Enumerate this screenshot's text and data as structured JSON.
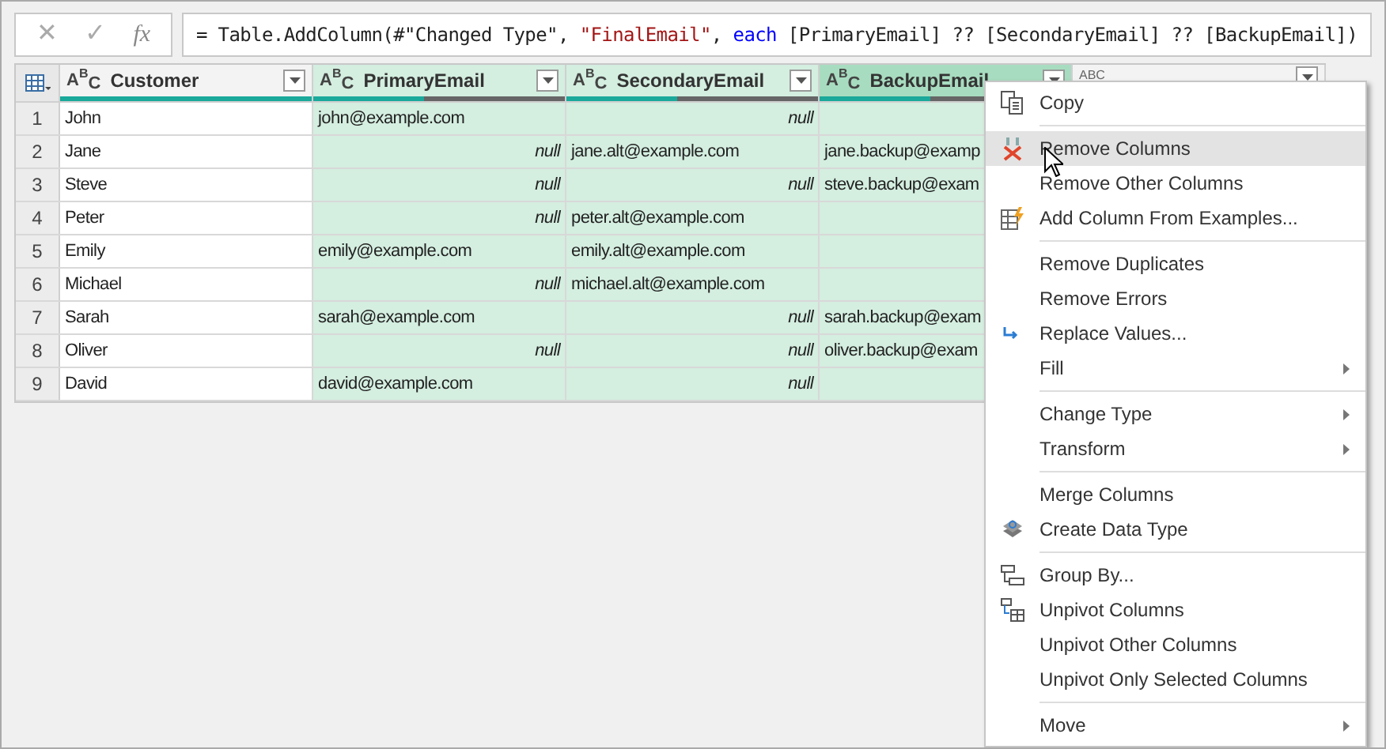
{
  "formula_bar": {
    "cancel_label": "✕",
    "confirm_label": "✓",
    "fx_label": "fx",
    "segments": [
      {
        "kind": "plain",
        "text": "= Table.AddColumn(#\"Changed Type\", "
      },
      {
        "kind": "string",
        "text": "\"FinalEmail\""
      },
      {
        "kind": "plain",
        "text": ", "
      },
      {
        "kind": "keyword",
        "text": "each"
      },
      {
        "kind": "plain",
        "text": " [PrimaryEmail] ?? [SecondaryEmail] ?? [BackupEmail])"
      }
    ]
  },
  "table": {
    "columns": [
      {
        "type_label": "ABC",
        "name": "Customer",
        "selected": false,
        "focused": false,
        "level": 1
      },
      {
        "type_label": "ABC",
        "name": "PrimaryEmail",
        "selected": true,
        "focused": false,
        "level": 0.44
      },
      {
        "type_label": "ABC",
        "name": "SecondaryEmail",
        "selected": true,
        "focused": false,
        "level": 0.44
      },
      {
        "type_label": "ABC",
        "name": "BackupEmail",
        "selected": true,
        "focused": true,
        "level": 0.44
      },
      {
        "type_label": "ABC",
        "selected": false,
        "focused": false
      }
    ],
    "rows": [
      {
        "number": "1",
        "cells": [
          "John",
          "john@example.com",
          "null",
          "",
          ""
        ]
      },
      {
        "number": "2",
        "cells": [
          "Jane",
          "null",
          "jane.alt@example.com",
          "jane.backup@examp",
          ""
        ]
      },
      {
        "number": "3",
        "cells": [
          "Steve",
          "null",
          "null",
          "steve.backup@exam",
          ""
        ]
      },
      {
        "number": "4",
        "cells": [
          "Peter",
          "null",
          "peter.alt@example.com",
          "",
          ""
        ]
      },
      {
        "number": "5",
        "cells": [
          "Emily",
          "emily@example.com",
          "emily.alt@example.com",
          "",
          ""
        ]
      },
      {
        "number": "6",
        "cells": [
          "Michael",
          "null",
          "michael.alt@example.com",
          "",
          ""
        ]
      },
      {
        "number": "7",
        "cells": [
          "Sarah",
          "sarah@example.com",
          "null",
          "sarah.backup@exam",
          ""
        ]
      },
      {
        "number": "8",
        "cells": [
          "Oliver",
          "null",
          "null",
          "oliver.backup@exam",
          ""
        ]
      },
      {
        "number": "9",
        "cells": [
          "David",
          "david@example.com",
          "null",
          "",
          ""
        ]
      }
    ]
  },
  "context_menu": {
    "items": [
      {
        "kind": "copy",
        "label": "Copy",
        "submenu": false,
        "selected": false
      },
      {
        "kind": "separator"
      },
      {
        "kind": "remove",
        "label": "Remove Columns",
        "submenu": false,
        "selected": true
      },
      {
        "kind": "item",
        "label": "Remove Other Columns",
        "submenu": false,
        "selected": false
      },
      {
        "kind": "examples",
        "label": "Add Column From Examples...",
        "submenu": false,
        "selected": false
      },
      {
        "kind": "separator"
      },
      {
        "kind": "item",
        "label": "Remove Duplicates",
        "submenu": false,
        "selected": false
      },
      {
        "kind": "item",
        "label": "Remove Errors",
        "submenu": false,
        "selected": false
      },
      {
        "kind": "replace",
        "label": "Replace Values...",
        "submenu": false,
        "selected": false
      },
      {
        "kind": "item",
        "label": "Fill",
        "submenu": true,
        "selected": false
      },
      {
        "kind": "separator"
      },
      {
        "kind": "item",
        "label": "Change Type",
        "submenu": true,
        "selected": false
      },
      {
        "kind": "item",
        "label": "Transform",
        "submenu": true,
        "selected": false
      },
      {
        "kind": "separator"
      },
      {
        "kind": "item",
        "label": "Merge Columns",
        "submenu": false,
        "selected": false
      },
      {
        "kind": "datatype",
        "label": "Create Data Type",
        "submenu": false,
        "selected": false
      },
      {
        "kind": "separator"
      },
      {
        "kind": "group",
        "label": "Group By...",
        "submenu": false,
        "selected": false
      },
      {
        "kind": "unpivot",
        "label": "Unpivot Columns",
        "submenu": false,
        "selected": false
      },
      {
        "kind": "item",
        "label": "Unpivot Other Columns",
        "submenu": false,
        "selected": false
      },
      {
        "kind": "item",
        "label": "Unpivot Only Selected Columns",
        "submenu": false,
        "selected": false
      },
      {
        "kind": "separator"
      },
      {
        "kind": "item",
        "label": "Move",
        "submenu": true,
        "selected": false
      }
    ]
  }
}
